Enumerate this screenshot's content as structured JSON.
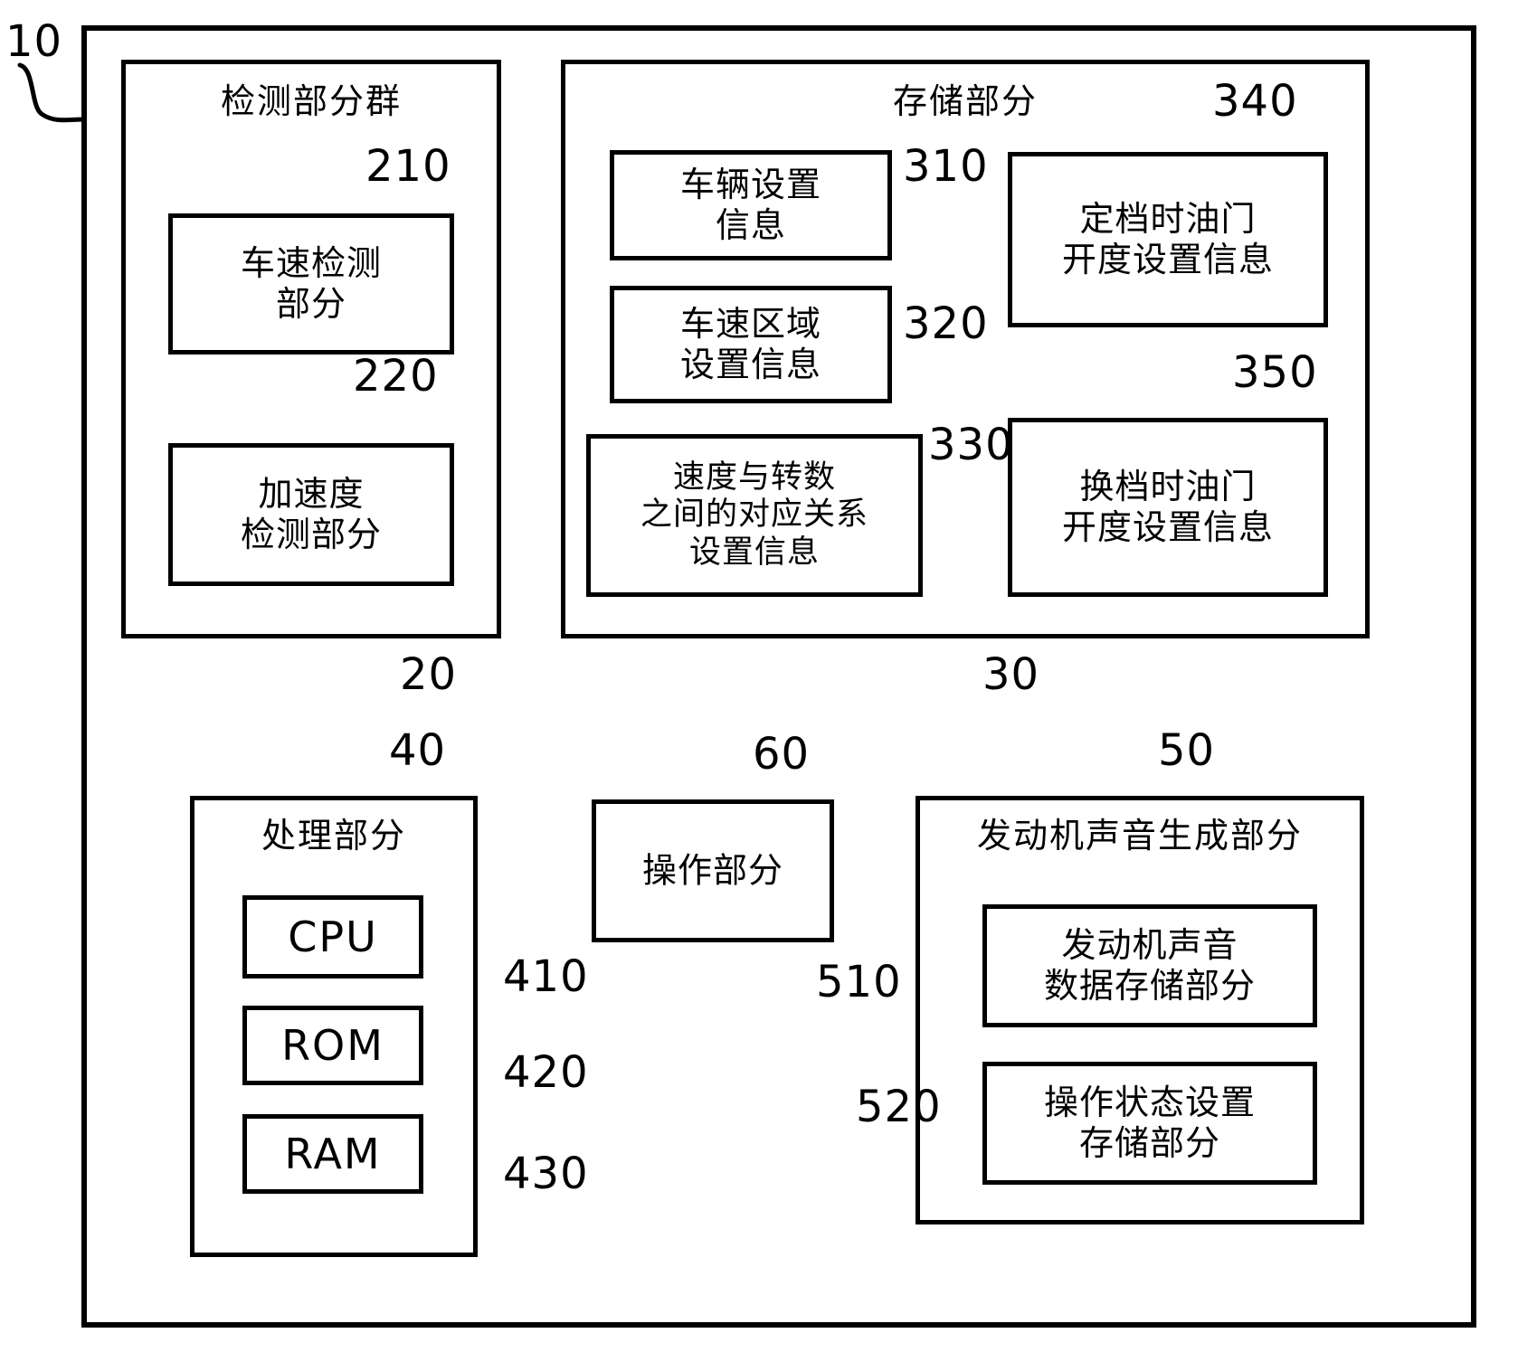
{
  "figure": {
    "outer_frame_ref": "10",
    "sections": {
      "detection_group": {
        "ref": "20",
        "title": "检测部分群",
        "boxes": [
          {
            "ref": "210",
            "lines": [
              "车速检测",
              "部分"
            ]
          },
          {
            "ref": "220",
            "lines": [
              "加速度",
              "检测部分"
            ]
          }
        ]
      },
      "storage": {
        "ref": "30",
        "title": "存储部分",
        "boxes": [
          {
            "ref": "310",
            "lines": [
              "车辆设置",
              "信息"
            ]
          },
          {
            "ref": "320",
            "lines": [
              "车速区域",
              "设置信息"
            ]
          },
          {
            "ref": "330",
            "lines": [
              "速度与转数",
              "之间的对应关系",
              "设置信息"
            ]
          },
          {
            "ref": "340",
            "lines": [
              "定档时油门",
              "开度设置信息"
            ]
          },
          {
            "ref": "350",
            "lines": [
              "换档时油门",
              "开度设置信息"
            ]
          }
        ]
      },
      "processing": {
        "ref": "40",
        "title": "处理部分",
        "boxes": [
          {
            "ref": "410",
            "lines": [
              "CPU"
            ]
          },
          {
            "ref": "420",
            "lines": [
              "ROM"
            ]
          },
          {
            "ref": "430",
            "lines": [
              "RAM"
            ]
          }
        ]
      },
      "operation": {
        "ref": "60",
        "title": "操作部分",
        "boxes": []
      },
      "engine_sound": {
        "ref": "50",
        "title": "发动机声音生成部分",
        "boxes": [
          {
            "ref": "510",
            "lines": [
              "发动机声音",
              "数据存储部分"
            ]
          },
          {
            "ref": "520",
            "lines": [
              "操作状态设置",
              "存储部分"
            ]
          }
        ]
      }
    }
  },
  "colors": {
    "line": "#000000",
    "background": "#ffffff"
  }
}
